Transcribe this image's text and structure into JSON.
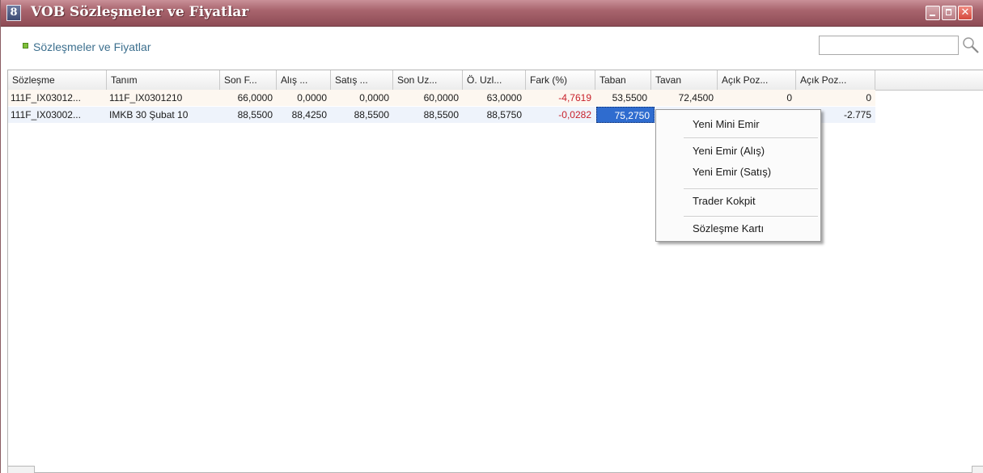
{
  "window": {
    "title": "VOB Sözleşmeler ve Fiyatlar",
    "icon_glyph": "8",
    "icon": "app-icon",
    "accent_color": "#9c5a63",
    "close_glyph": "✕"
  },
  "header": {
    "section_title": "Sözleşmeler ve Fiyatlar",
    "search": {
      "value": "",
      "placeholder": ""
    }
  },
  "table": {
    "columns": [
      "Sözleşme",
      "Tanım",
      "Son F...",
      "Alış ...",
      "Satış ...",
      "Son Uz...",
      "Ö. Uzl...",
      "Fark (%)",
      "Taban",
      "Tavan",
      "Açık Poz...",
      "Açık Poz..."
    ],
    "rows": [
      [
        "111F_IX03012...",
        "111F_IX0301210",
        "66,0000",
        "0,0000",
        "0,0000",
        "60,0000",
        "63,0000",
        "-4,7619",
        "53,5500",
        "72,4500",
        "0",
        "0"
      ],
      [
        "111F_IX03002...",
        "IMKB 30 Şubat 10",
        "88,5500",
        "88,4250",
        "88,5500",
        "88,5500",
        "88,5750",
        "-0,0282",
        "75,2750",
        "",
        "",
        "-2.775"
      ]
    ],
    "negative_color": "#c8202a",
    "selection_color": "#2f6ccf"
  },
  "context_menu": {
    "items": [
      "Yeni Mini Emir",
      "Yeni Emir (Alış)",
      "Yeni Emir (Satış)",
      "Trader Kokpit",
      "Sözleşme Kartı"
    ]
  }
}
